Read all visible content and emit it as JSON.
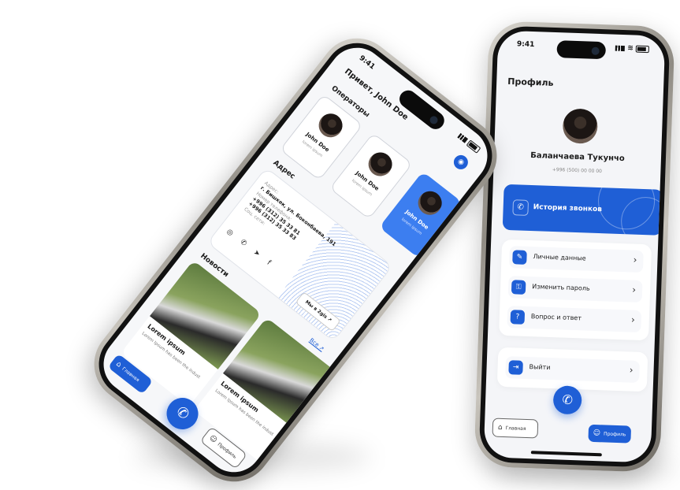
{
  "profile_screen": {
    "status_time": "9:41",
    "title": "Профиль",
    "user_name": "Баланчаева Тукунчо",
    "user_phone": "+996 (500) 00 00 00",
    "call_history_label": "История звонков",
    "menu": [
      {
        "label": "Личные данные",
        "icon": "edit-icon"
      },
      {
        "label": "Изменить пароль",
        "icon": "key-icon"
      },
      {
        "label": "Вопрос и ответ",
        "icon": "help-icon"
      }
    ],
    "logout_label": "Выйти",
    "nav": {
      "home": "Главная",
      "profile": "Профиль"
    },
    "accent_color": "#1f5fd6"
  },
  "home_screen": {
    "status_time": "9:41",
    "greeting": "Привет, John Doe",
    "operators_heading": "Операторы",
    "operators": [
      {
        "name": "John Doe",
        "subtitle": "lorem ipsum"
      },
      {
        "name": "John Doe",
        "subtitle": "lorem ipsum"
      },
      {
        "name": "John Doe",
        "subtitle": "lorem ipsum"
      }
    ],
    "address_heading": "Адрес",
    "address": {
      "label": "Адрес:",
      "value": "г. Бишкек, ул. Боконбаева, 191",
      "phone_label": "Номер телефона:",
      "phone_1": "+996 (312) 35 33 81",
      "phone_2": "+996 (312) 35 33 83",
      "social_label": "Соц. сети:",
      "map_button": "Мы в 2gis"
    },
    "news_heading": "Новости",
    "news_all": "Все",
    "news": [
      {
        "title": "Lorem ipsum",
        "desc": "Lorem Ipsum has been the indust"
      },
      {
        "title": "Lorem ipsum",
        "desc": "Lorem Ipsum has been the indust"
      }
    ],
    "nav": {
      "home": "Главная",
      "profile": "Профиль"
    }
  }
}
